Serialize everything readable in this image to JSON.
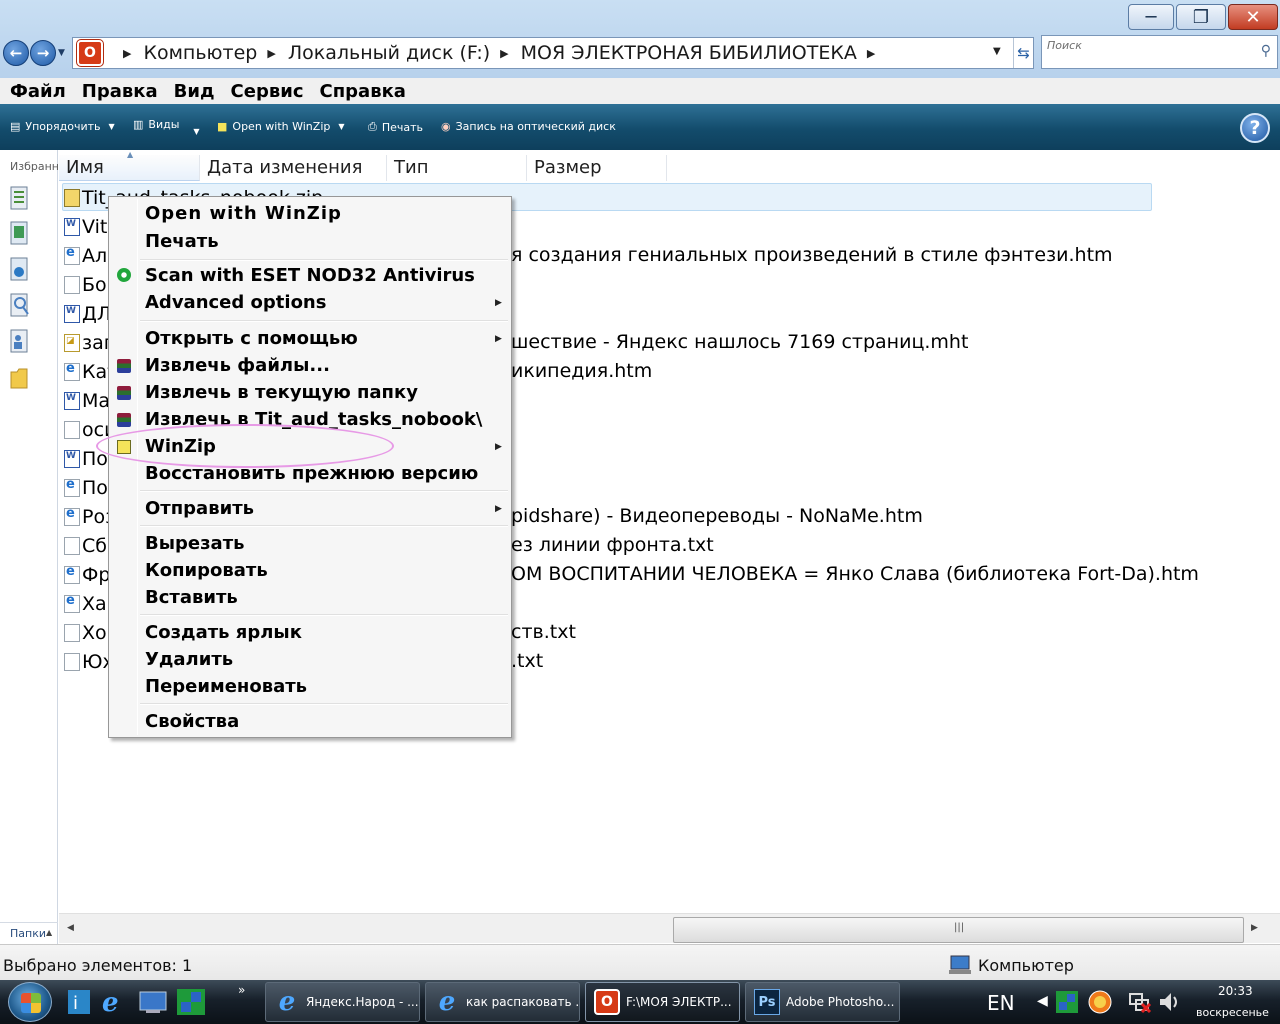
{
  "window": {
    "minimize_glyph": "─",
    "maximize_glyph": "❐",
    "close_glyph": "✕"
  },
  "address": {
    "breadcrumb": [
      "Компьютер",
      "Локальный диск (F:)",
      "МОЯ ЭЛЕКТРОНАЯ БИБИЛИОТЕКА"
    ],
    "search_placeholder": "Поиск"
  },
  "menubar": [
    "Файл",
    "Правка",
    "Вид",
    "Сервис",
    "Справка"
  ],
  "commandbar": {
    "organize": "Упорядочить",
    "views": "Виды",
    "open_winzip": "Open with WinZip",
    "print": "Печать",
    "burn": "Запись на оптический диск"
  },
  "navpane": {
    "favorites_label": "Избранн",
    "folders_label": "Папки"
  },
  "columns": [
    "Имя",
    "Дата изменения",
    "Тип",
    "Размер"
  ],
  "files": [
    {
      "name": "Tit_aud_tasks_nobook.zip",
      "icon": "zip"
    },
    {
      "name": "Vit",
      "icon": "doc"
    },
    {
      "name": "Ал",
      "icon": "htm"
    },
    {
      "name": "Бор",
      "icon": "txt"
    },
    {
      "name": "ДЛ",
      "icon": "doc"
    },
    {
      "name": "заг",
      "icon": "mht"
    },
    {
      "name": "Кат",
      "icon": "htm"
    },
    {
      "name": "Ма",
      "icon": "doc"
    },
    {
      "name": "оси",
      "icon": "txt"
    },
    {
      "name": "По",
      "icon": "doc"
    },
    {
      "name": "По",
      "icon": "htm"
    },
    {
      "name": "Роз",
      "icon": "htm"
    },
    {
      "name": "Сбо",
      "icon": "txt"
    },
    {
      "name": "Фр",
      "icon": "htm"
    },
    {
      "name": "Хан",
      "icon": "htm"
    },
    {
      "name": "Хор",
      "icon": "txt"
    },
    {
      "name": "Юх",
      "icon": "txt"
    }
  ],
  "file_tails": {
    "alo": "я создания гениальных произведений в стиле фэнтези.htm",
    "zag": "шествие - Яндекс нашлось 7169 страниц.mht",
    "kat": "икипедия.htm",
    "roz": "pidshare) - Видеопереводы - NoNaMe.htm",
    "sbo": "ез линии фронта.txt",
    "fr": "ОМ ВОСПИТАНИИ ЧЕЛОВЕКА = Янко Слава (библиотека Fort-Da).htm",
    "hor": "ств.txt",
    "yuh": ".txt"
  },
  "context_menu": {
    "open_winzip": "Open with WinZip",
    "print": "Печать",
    "scan_eset": "Scan with ESET NOD32 Antivirus",
    "advanced": "Advanced options",
    "open_with": "Открыть с помощью",
    "extract_files": "Извлечь файлы...",
    "extract_here": "Извлечь в текущую папку",
    "extract_to": "Извлечь в Tit_aud_tasks_nobook\\",
    "winzip": "WinZip",
    "restore": "Восстановить прежнюю версию",
    "send_to": "Отправить",
    "cut": "Вырезать",
    "copy": "Копировать",
    "paste": "Вставить",
    "shortcut": "Создать ярлык",
    "delete": "Удалить",
    "rename": "Переименовать",
    "properties": "Свойства"
  },
  "statusbar": {
    "selection": "Выбрано элементов: 1",
    "location": "Компьютер"
  },
  "taskbar": {
    "tasks": [
      "Яндекс.Народ - ...",
      "как распаковать ...",
      "F:\\МОЯ ЭЛЕКТР...",
      "Adobe Photosho..."
    ],
    "language": "EN",
    "time": "20:33",
    "day": "воскресенье"
  },
  "colors": {
    "commandbar": "#134c6c",
    "selection": "#e6f2fb",
    "highlight_ellipse": "#e79ae6",
    "taskbar": "#17202a"
  },
  "icons": [
    "back-icon",
    "forward-icon",
    "opera-icon",
    "refresh-icon",
    "search-icon",
    "help-icon",
    "rar-icon",
    "eset-icon",
    "winzip-icon",
    "computer-icon",
    "windows-start-icon",
    "ie-icon",
    "photoshop-icon",
    "volume-icon",
    "network-icon"
  ]
}
